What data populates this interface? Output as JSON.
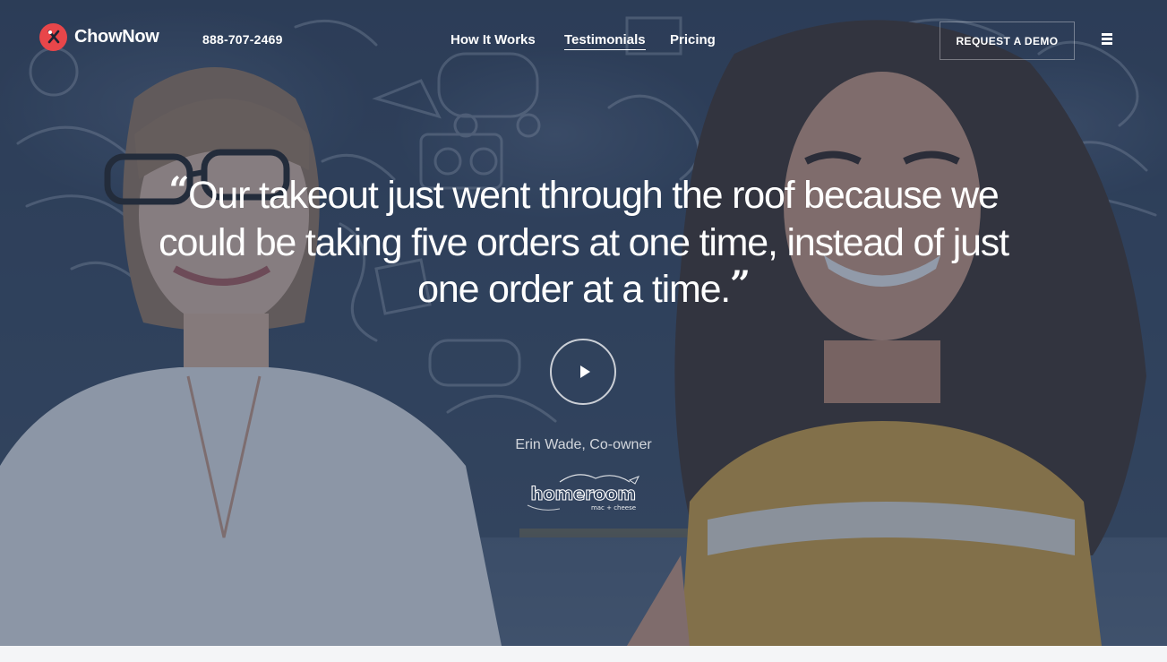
{
  "header": {
    "brand_name": "ChowNow",
    "phone": "888-707-2469",
    "nav": [
      {
        "label": "How It Works",
        "active": false
      },
      {
        "label": "Testimonials",
        "active": true
      },
      {
        "label": "Pricing",
        "active": false
      }
    ],
    "cta_label": "REQUEST A DEMO",
    "menu_icon": "hamburger-menu-icon"
  },
  "testimonial": {
    "quote": "Our takeout just went through the roof because we could be taking five orders at one time, instead of just one order at a time.",
    "open_mark": "“",
    "close_mark": "”",
    "author": "Erin Wade, Co-owner",
    "play_icon": "play-icon",
    "business_logo": {
      "name": "homeroom",
      "tagline": "mac + cheese"
    }
  },
  "colors": {
    "brand_red": "#e8464a",
    "overlay": "#2c3e5a",
    "text": "#ffffff"
  }
}
